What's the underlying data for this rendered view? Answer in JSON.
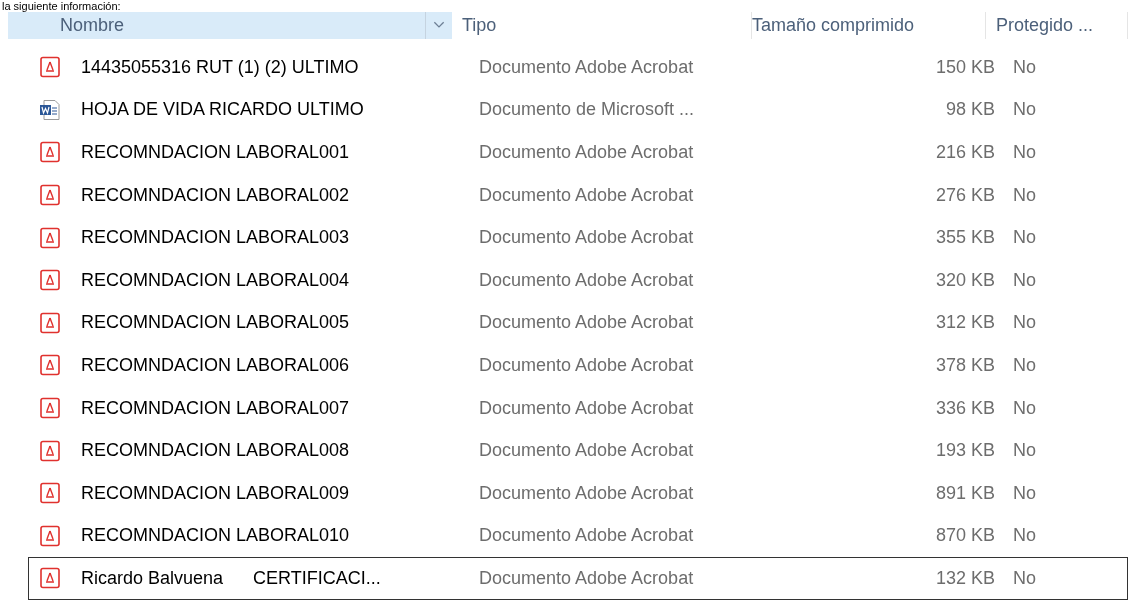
{
  "intro_text": "la siguiente información:",
  "columns": [
    {
      "label": "Nombre",
      "hot": true
    },
    {
      "label": "Tipo",
      "hot": false
    },
    {
      "label": "Tamaño comprimido",
      "hot": false
    },
    {
      "label": "Protegido ...",
      "hot": false
    }
  ],
  "rows": [
    {
      "kind": "pdf",
      "name": "14435055316 RUT (1) (2) ULTIMO",
      "type": "Documento Adobe Acrobat",
      "size": "150 KB",
      "protected": "No",
      "focused": false
    },
    {
      "kind": "word",
      "name": "HOJA DE VIDA RICARDO ULTIMO",
      "type": "Documento de Microsoft ...",
      "size": "98 KB",
      "protected": "No",
      "focused": false
    },
    {
      "kind": "pdf",
      "name": "RECOMNDACION LABORAL001",
      "type": "Documento Adobe Acrobat",
      "size": "216 KB",
      "protected": "No",
      "focused": false
    },
    {
      "kind": "pdf",
      "name": "RECOMNDACION LABORAL002",
      "type": "Documento Adobe Acrobat",
      "size": "276 KB",
      "protected": "No",
      "focused": false
    },
    {
      "kind": "pdf",
      "name": "RECOMNDACION LABORAL003",
      "type": "Documento Adobe Acrobat",
      "size": "355 KB",
      "protected": "No",
      "focused": false
    },
    {
      "kind": "pdf",
      "name": "RECOMNDACION LABORAL004",
      "type": "Documento Adobe Acrobat",
      "size": "320 KB",
      "protected": "No",
      "focused": false
    },
    {
      "kind": "pdf",
      "name": "RECOMNDACION LABORAL005",
      "type": "Documento Adobe Acrobat",
      "size": "312 KB",
      "protected": "No",
      "focused": false
    },
    {
      "kind": "pdf",
      "name": "RECOMNDACION LABORAL006",
      "type": "Documento Adobe Acrobat",
      "size": "378 KB",
      "protected": "No",
      "focused": false
    },
    {
      "kind": "pdf",
      "name": "RECOMNDACION LABORAL007",
      "type": "Documento Adobe Acrobat",
      "size": "336 KB",
      "protected": "No",
      "focused": false
    },
    {
      "kind": "pdf",
      "name": "RECOMNDACION LABORAL008",
      "type": "Documento Adobe Acrobat",
      "size": "193 KB",
      "protected": "No",
      "focused": false
    },
    {
      "kind": "pdf",
      "name": "RECOMNDACION LABORAL009",
      "type": "Documento Adobe Acrobat",
      "size": "891 KB",
      "protected": "No",
      "focused": false
    },
    {
      "kind": "pdf",
      "name": "RECOMNDACION LABORAL010",
      "type": "Documento Adobe Acrobat",
      "size": "870 KB",
      "protected": "No",
      "focused": false
    },
    {
      "kind": "pdf",
      "name": "Ricardo Balvuena      CERTIFICACI...",
      "type": "Documento Adobe Acrobat",
      "size": "132 KB",
      "protected": "No",
      "focused": true
    }
  ]
}
